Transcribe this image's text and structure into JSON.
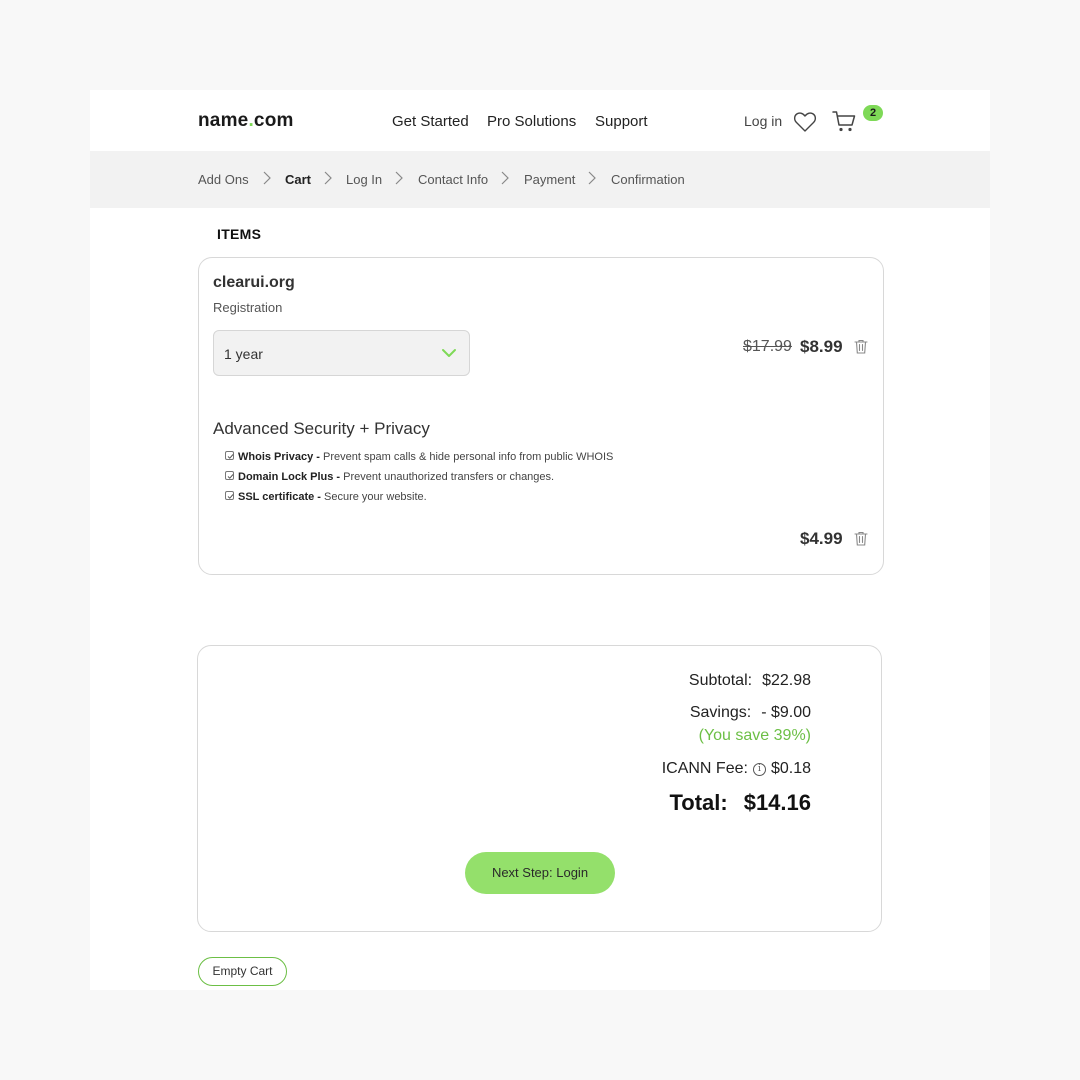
{
  "header": {
    "logo_left": "name",
    "logo_dot": ".",
    "logo_right": "com",
    "nav": [
      "Get Started",
      "Pro Solutions",
      "Support"
    ],
    "login": "Log in",
    "cart_count": "2",
    "icons": [
      "heart-icon",
      "cart-icon"
    ]
  },
  "breadcrumb": {
    "steps": [
      "Add Ons",
      "Cart",
      "Log In",
      "Contact Info",
      "Payment",
      "Confirmation"
    ],
    "active": "Cart"
  },
  "items": {
    "title": "ITEMS",
    "domain": "clearui.org",
    "type": "Registration",
    "term": "1 year",
    "old_price": "$17.99",
    "price": "$8.99",
    "addon_title": "Advanced Security + Privacy",
    "features": [
      {
        "name": "Whois Privacy -",
        "desc": " Prevent spam calls & hide personal info from public WHOIS"
      },
      {
        "name": "Domain Lock Plus -",
        "desc": " Prevent unauthorized transfers or changes."
      },
      {
        "name": "SSL certificate -",
        "desc": " Secure your website."
      }
    ],
    "addon_price": "$4.99"
  },
  "summary": {
    "subtotal_label": "Subtotal:",
    "subtotal": "$22.98",
    "savings_label": "Savings:",
    "savings": "- $9.00",
    "savings_pct": "(You save 39%)",
    "icann_label": "ICANN Fee:",
    "icann_info": "i",
    "icann": "$0.18",
    "total_label": "Total:",
    "total": "$14.16",
    "next_button": "Next Step: Login"
  },
  "empty_cart": "Empty Cart",
  "colors": {
    "accent": "#7ed957",
    "button": "#94e06b",
    "savings_text": "#6cbf45",
    "breadcrumb_bg": "#f2f2f2"
  }
}
